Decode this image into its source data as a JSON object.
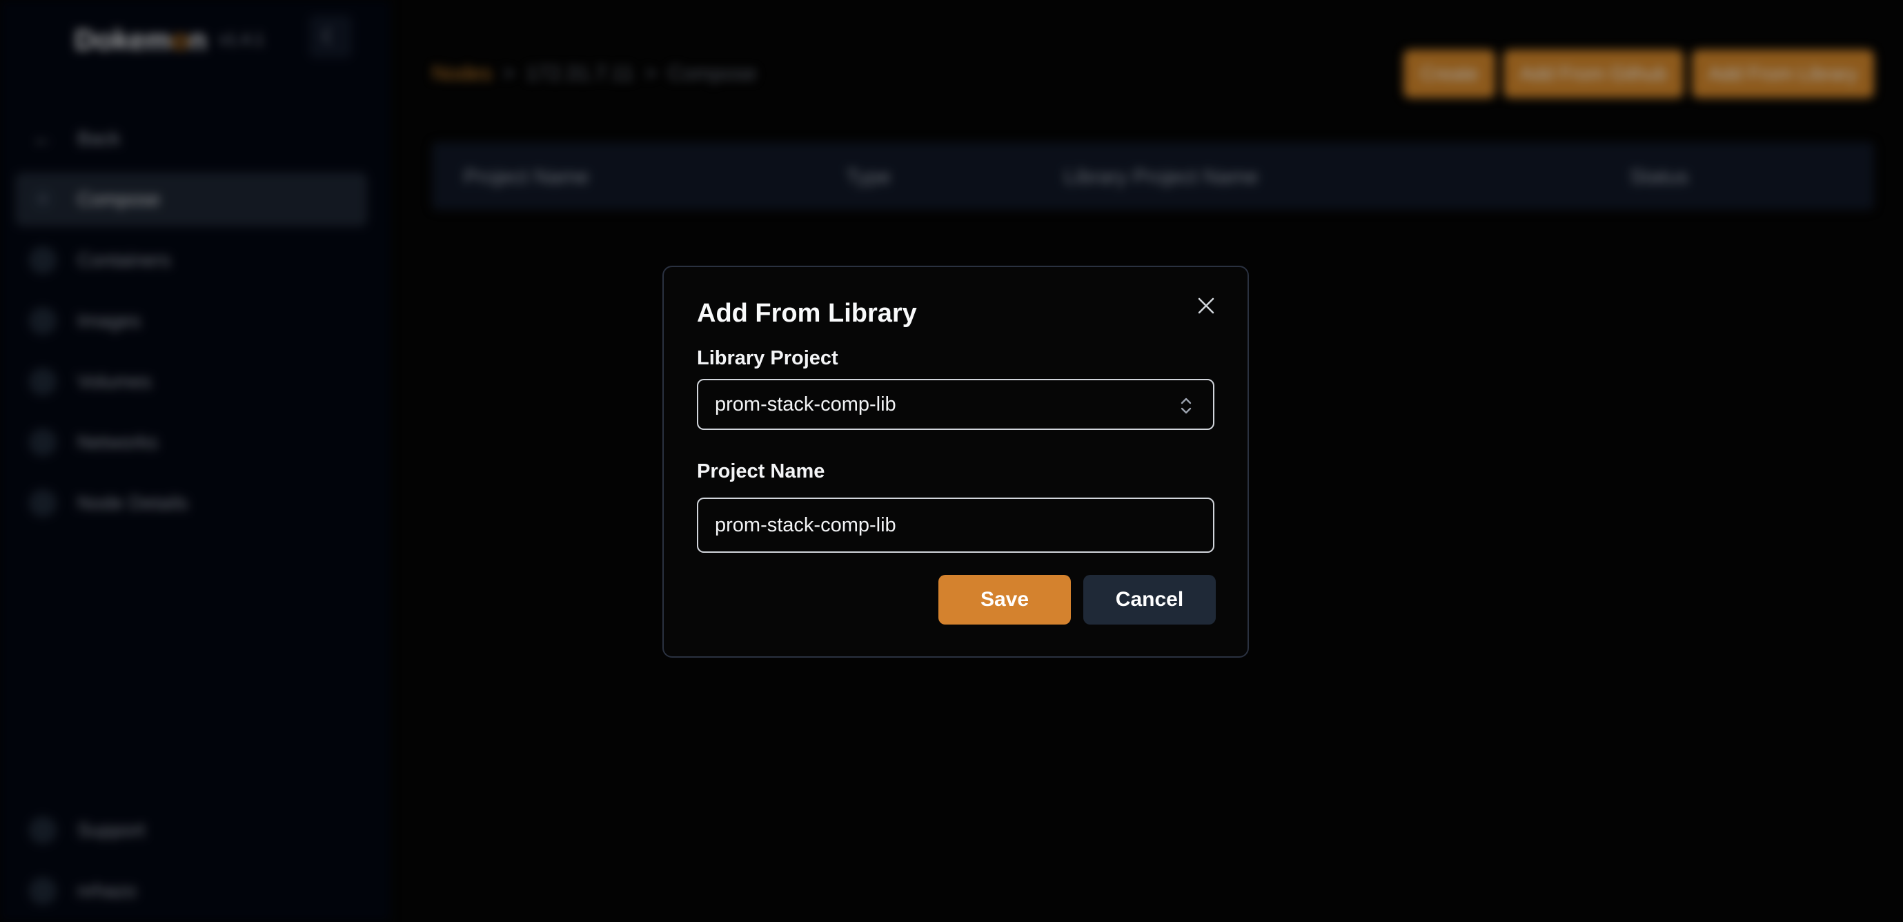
{
  "app": {
    "logo_prefix": "Dokem",
    "logo_accent": "o",
    "logo_suffix": "n",
    "version": "v1.4.1",
    "theme_icon": "moon-icon"
  },
  "sidebar": {
    "items": [
      {
        "label": "Back",
        "icon": "arrow-left-icon"
      },
      {
        "label": "Compose",
        "icon": "layers-icon",
        "active": true
      },
      {
        "label": "Containers",
        "icon": "box-icon"
      },
      {
        "label": "Images",
        "icon": "image-icon"
      },
      {
        "label": "Volumes",
        "icon": "folder-icon"
      },
      {
        "label": "Networks",
        "icon": "globe-icon"
      },
      {
        "label": "Node Details",
        "icon": "monitor-icon"
      }
    ],
    "bottom_items": [
      {
        "label": "Support",
        "icon": "help-icon"
      },
      {
        "label": "nrhazo",
        "icon": "user-icon"
      }
    ]
  },
  "breadcrumb": {
    "root": "Nodes",
    "sep": ">",
    "node": "172.31.7.11",
    "current": "Compose"
  },
  "actions": {
    "create": "Create",
    "add_github": "Add From Github",
    "add_library": "Add From Library"
  },
  "table": {
    "headers": [
      "Project Name",
      "Type",
      "Library Project Name",
      "Status"
    ]
  },
  "dialog": {
    "title": "Add From Library",
    "library_project_label": "Library Project",
    "library_project_value": "prom-stack-comp-lib",
    "project_name_label": "Project Name",
    "project_name_value": "prom-stack-comp-lib",
    "save": "Save",
    "cancel": "Cancel"
  },
  "colors": {
    "accent": "#d4822e",
    "dialog_bg": "#060606",
    "cancel_bg": "#1f2937"
  }
}
